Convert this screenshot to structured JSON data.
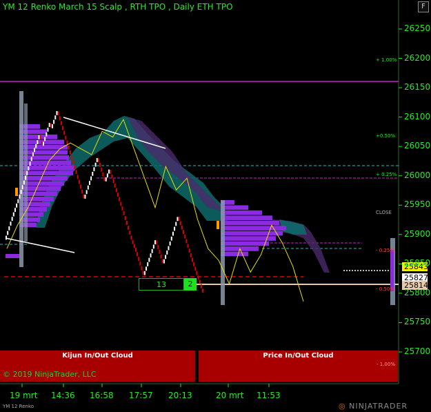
{
  "window": {
    "title": "YM 12 Renko March 15 Scalp , RTH TPO , Daily ETH TPO",
    "button_label": "F",
    "instrument_label": "YM 12 Renko",
    "brand": "NINJATRADER"
  },
  "colors": {
    "background": "#000000",
    "axis_text": "#22ee22",
    "up_brick": "#ffffff",
    "down_brick": "#e00000",
    "tpo_profile": "#8a2be2",
    "cloud": "#0e6a6a",
    "panel": "#a80000",
    "magenta_line": "#cc22cc",
    "cyan_line": "#22bbcc"
  },
  "bottom_panels": {
    "kijun": "Kijun In/Out Cloud",
    "price": "Price In/Out Cloud",
    "copyright": "© 2019 NinjaTrader, LLC",
    "pct_label": "- 1.00%"
  },
  "counter": {
    "left": "13",
    "right": "2"
  },
  "annotations": {
    "close": "CLOSE",
    "pct": [
      "+ 1.00%",
      "+0.50%",
      "+ 0.25%",
      "- 0.25%",
      "- 0.50%"
    ]
  },
  "price_tags": {
    "green": "25843",
    "white": "25827",
    "tan": "25814"
  },
  "chart_data": {
    "type": "line",
    "title": "YM 12 Renko March 15 Scalp , RTH TPO , Daily ETH TPO",
    "x_ticks": [
      "19 mrt",
      "14:36",
      "16:58",
      "17:57",
      "20:13",
      "20 mrt",
      "11:53"
    ],
    "y_ticks": [
      25700,
      25750,
      25800,
      25850,
      25900,
      25950,
      26000,
      26050,
      26100,
      26150,
      26200,
      26250
    ],
    "ylim": [
      25660,
      26280
    ],
    "reference_levels": [
      {
        "label": "+ 1.00%",
        "value": 26158
      },
      {
        "label": "+0.50%",
        "value": 26003
      },
      {
        "label": "+ 0.25%",
        "value": 25993
      },
      {
        "label": "- 0.25%",
        "value": 25880
      },
      {
        "label": "- 0.50%",
        "value": 25830
      }
    ],
    "series": [
      {
        "name": "YM 12 Renko",
        "values": [
          25890,
          25930,
          25960,
          26000,
          26040,
          26060,
          26070,
          26060,
          26050,
          26090,
          26080,
          26110,
          26060,
          26010,
          25960,
          26030,
          25990,
          26010,
          25940,
          25890,
          25870,
          25830,
          25890,
          25850,
          25880,
          25930,
          25900,
          25860,
          25800
        ]
      }
    ],
    "grid": false
  }
}
